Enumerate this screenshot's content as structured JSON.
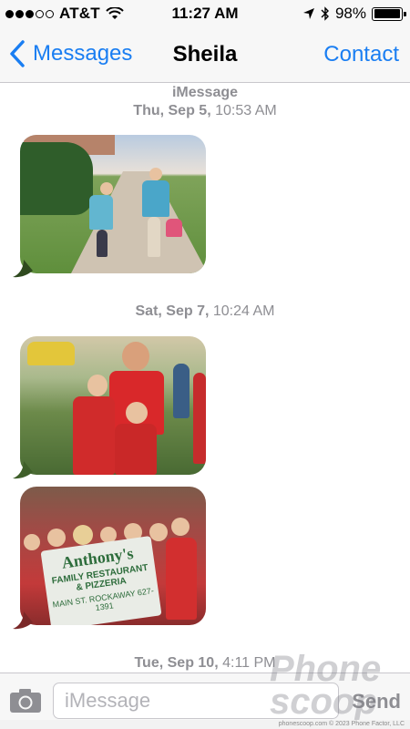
{
  "status_bar": {
    "carrier": "AT&T",
    "signal_bars": 3,
    "signal_total": 5,
    "time": "11:27 AM",
    "battery_percent": "98%",
    "battery_level": 0.98
  },
  "nav": {
    "back_label": "Messages",
    "title": "Sheila",
    "contact_label": "Contact"
  },
  "conversation": {
    "service": "iMessage",
    "stamps": [
      {
        "day": "Thu, Sep 5,",
        "time": "10:53 AM"
      },
      {
        "day": "Sat, Sep 7,",
        "time": "10:24 AM"
      },
      {
        "day": "Tue, Sep 10,",
        "time": "4:11 PM"
      }
    ],
    "banner_text": {
      "line1": "Anthony's",
      "line2": "FAMILY RESTAURANT",
      "line3": "& PIZZERIA",
      "line4": "MAIN ST. ROCKAWAY 627-1391"
    }
  },
  "input": {
    "placeholder": "iMessage",
    "send_label": "Send"
  },
  "watermark": {
    "brand": "Phone scoop",
    "credit": "phonescoop.com  © 2023 Phone Factor, LLC"
  },
  "colors": {
    "accent": "#1a7ef2",
    "bubble_received": "#e5e5ea"
  }
}
